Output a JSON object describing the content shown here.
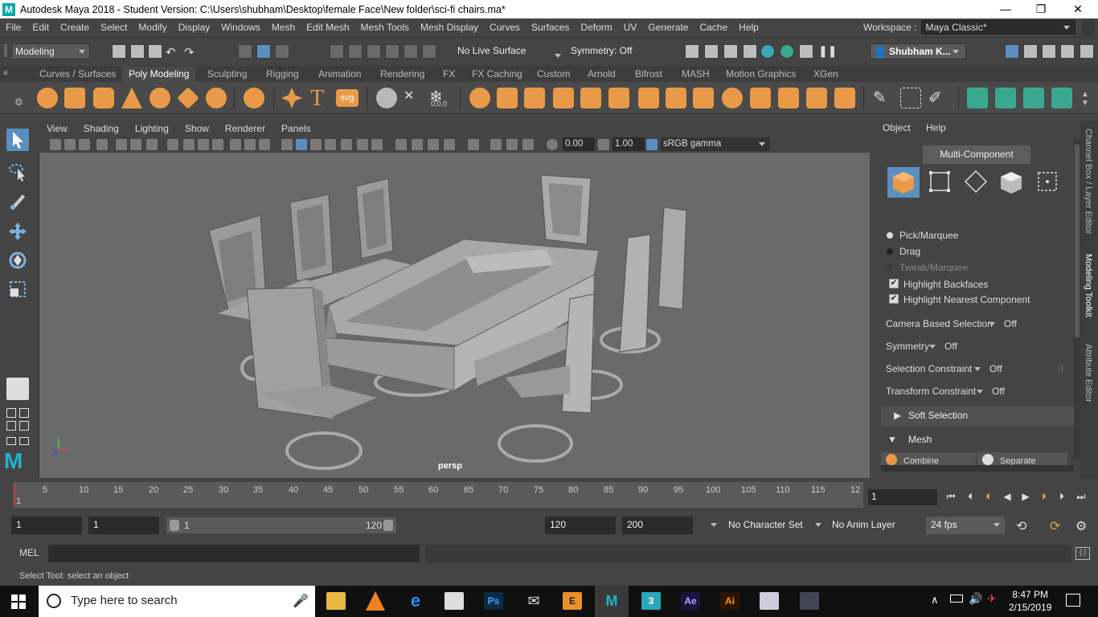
{
  "window": {
    "title": "Autodesk Maya 2018 - Student Version: C:\\Users\\shubham\\Desktop\\female Face\\New folder\\sci-fi chairs.ma*",
    "logo": "M",
    "minimize": "—",
    "restore": "❐",
    "close": "✕"
  },
  "menubar": {
    "items": [
      "File",
      "Edit",
      "Create",
      "Select",
      "Modify",
      "Display",
      "Windows",
      "Mesh",
      "Edit Mesh",
      "Mesh Tools",
      "Mesh Display",
      "Curves",
      "Surfaces",
      "Deform",
      "UV",
      "Generate",
      "Cache",
      "Help"
    ],
    "workspace_label": "Workspace :",
    "workspace_value": "Maya Classic*"
  },
  "statusline": {
    "menuset": "Modeling",
    "live_surface": "No Live Surface",
    "symmetry": "Symmetry: Off",
    "user": "Shubham K..."
  },
  "shelf": {
    "tabs": [
      "Curves / Surfaces",
      "Poly Modeling",
      "Sculpting",
      "Rigging",
      "Animation",
      "Rendering",
      "FX",
      "FX Caching",
      "Custom",
      "Arnold",
      "Bifrost",
      "MASH",
      "Motion Graphics",
      "XGen"
    ],
    "active_tab": "Poly Modeling",
    "svg_label": "svg",
    "text_label": "T",
    "coord_label": "0,0,0"
  },
  "viewport": {
    "menu": [
      "View",
      "Shading",
      "Lighting",
      "Show",
      "Renderer",
      "Panels"
    ],
    "exposure": "0.00",
    "gamma": "1.00",
    "colorspace": "sRGB gamma",
    "camera": "persp"
  },
  "panel": {
    "tab_object": "Object",
    "tab_help": "Help",
    "multi_component": "Multi-Component",
    "pick_marquee": "Pick/Marquee",
    "drag": "Drag",
    "tweak_marquee": "Tweak/Marquee",
    "highlight_backfaces": "Highlight Backfaces",
    "highlight_nearest": "Highlight Nearest Component",
    "camera_based_selection": "Camera Based Selection",
    "camera_based_value": "Off",
    "symmetry": "Symmetry",
    "symmetry_value": "Off",
    "selection_constraint": "Selection Constraint",
    "selection_constraint_value": "Off",
    "selection_constraint_num": "0",
    "transform_constraint": "Transform Constraint",
    "transform_constraint_value": "Off",
    "soft_selection": "Soft Selection",
    "mesh": "Mesh",
    "combine": "Combine",
    "separate": "Separate",
    "side_tabs": [
      "Channel Box / Layer Editor",
      "Modeling Toolkit",
      "Attribute Editor"
    ]
  },
  "timeline": {
    "first_tick": "1",
    "ticks": [
      "5",
      "10",
      "15",
      "20",
      "25",
      "30",
      "35",
      "40",
      "45",
      "50",
      "55",
      "60",
      "65",
      "70",
      "75",
      "80",
      "85",
      "90",
      "95",
      "100",
      "105",
      "110",
      "115",
      "12"
    ],
    "current_frame": "1"
  },
  "range": {
    "start": "1",
    "playback_start": "1",
    "slider_start": "1",
    "slider_end": "120",
    "playback_end": "120",
    "end": "200",
    "character_set": "No Character Set",
    "anim_layer": "No Anim Layer",
    "fps": "24 fps"
  },
  "cmdline": {
    "mel": "MEL",
    "help": "Select Tool: select an object"
  },
  "taskbar": {
    "search_placeholder": "Type here to search",
    "time": "8:47 PM",
    "date": "2/15/2019",
    "apps": [
      "Ps",
      "3",
      "Ae",
      "Ai",
      "E",
      "M"
    ]
  },
  "colors": {
    "accent_orange": "#e99a48",
    "viewport_bg": "#6a6a6a",
    "active_blue": "#5a8fbf"
  }
}
